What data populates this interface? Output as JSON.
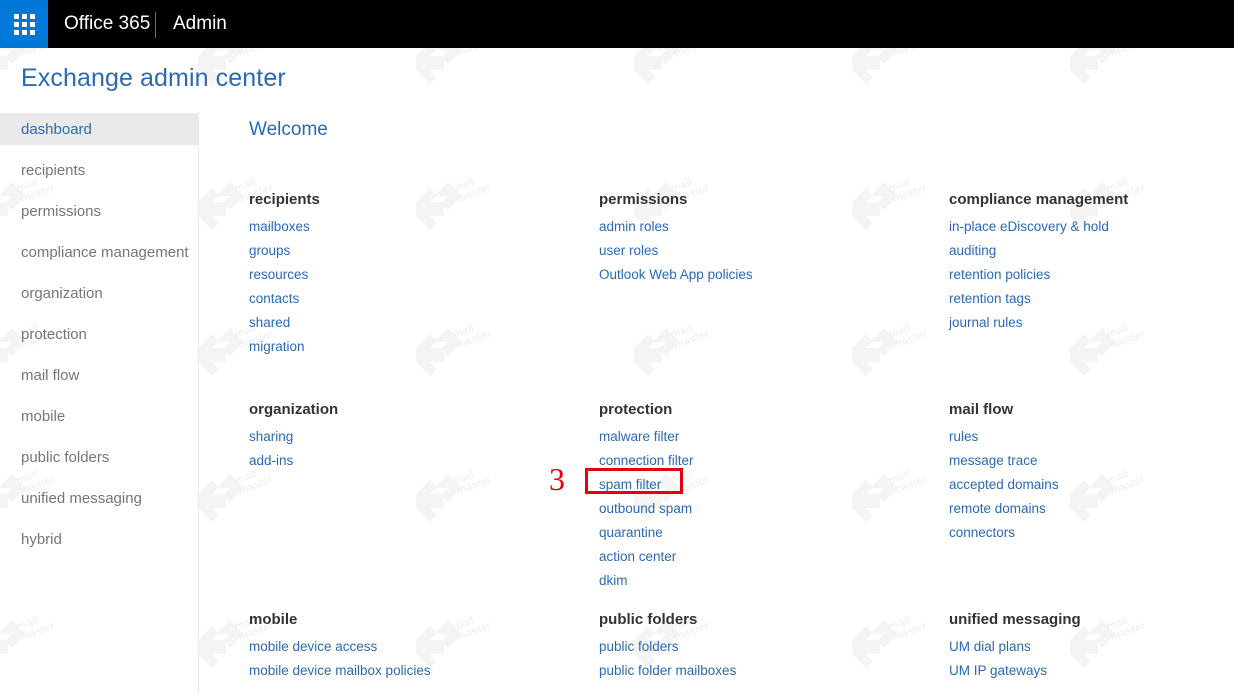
{
  "suite_bar": {
    "waffle_icon": "app-launcher-waffle-icon",
    "brand": "Office 365",
    "app_name": "Admin"
  },
  "page_title": "Exchange admin center",
  "sidebar": {
    "items": [
      {
        "label": "dashboard",
        "selected": true
      },
      {
        "label": "recipients",
        "selected": false
      },
      {
        "label": "permissions",
        "selected": false
      },
      {
        "label": "compliance management",
        "selected": false
      },
      {
        "label": "organization",
        "selected": false
      },
      {
        "label": "protection",
        "selected": false
      },
      {
        "label": "mail flow",
        "selected": false
      },
      {
        "label": "mobile",
        "selected": false
      },
      {
        "label": "public folders",
        "selected": false
      },
      {
        "label": "unified messaging",
        "selected": false
      },
      {
        "label": "hybrid",
        "selected": false
      }
    ]
  },
  "main": {
    "welcome_heading": "Welcome",
    "tiles": [
      {
        "title": "recipients",
        "links": [
          "mailboxes",
          "groups",
          "resources",
          "contacts",
          "shared",
          "migration"
        ]
      },
      {
        "title": "permissions",
        "links": [
          "admin roles",
          "user roles",
          "Outlook Web App policies"
        ]
      },
      {
        "title": "compliance management",
        "links": [
          "in-place eDiscovery & hold",
          "auditing",
          "retention policies",
          "retention tags",
          "journal rules"
        ]
      },
      {
        "title": "organization",
        "links": [
          "sharing",
          "add-ins"
        ]
      },
      {
        "title": "protection",
        "links": [
          "malware filter",
          "connection filter",
          "spam filter",
          "outbound spam",
          "quarantine",
          "action center",
          "dkim"
        ]
      },
      {
        "title": "mail flow",
        "links": [
          "rules",
          "message trace",
          "accepted domains",
          "remote domains",
          "connectors"
        ]
      },
      {
        "title": "mobile",
        "links": [
          "mobile device access",
          "mobile device mailbox policies"
        ]
      },
      {
        "title": "public folders",
        "links": [
          "public folders",
          "public folder mailboxes"
        ]
      },
      {
        "title": "unified messaging",
        "links": [
          "UM dial plans",
          "UM IP gateways"
        ]
      }
    ]
  },
  "annotation": {
    "number": "3",
    "target_label": "spam filter",
    "color": "#e3000f"
  },
  "watermark": {
    "text_line1": "mail",
    "text_line2": "master"
  },
  "colors": {
    "accent_blue": "#2a6ab4",
    "suite_bar_bg": "#000000",
    "waffle_bg": "#0078d7",
    "selected_nav_bg": "#eaeaea",
    "nav_text": "#767676",
    "annotation_red": "#e3000f"
  }
}
